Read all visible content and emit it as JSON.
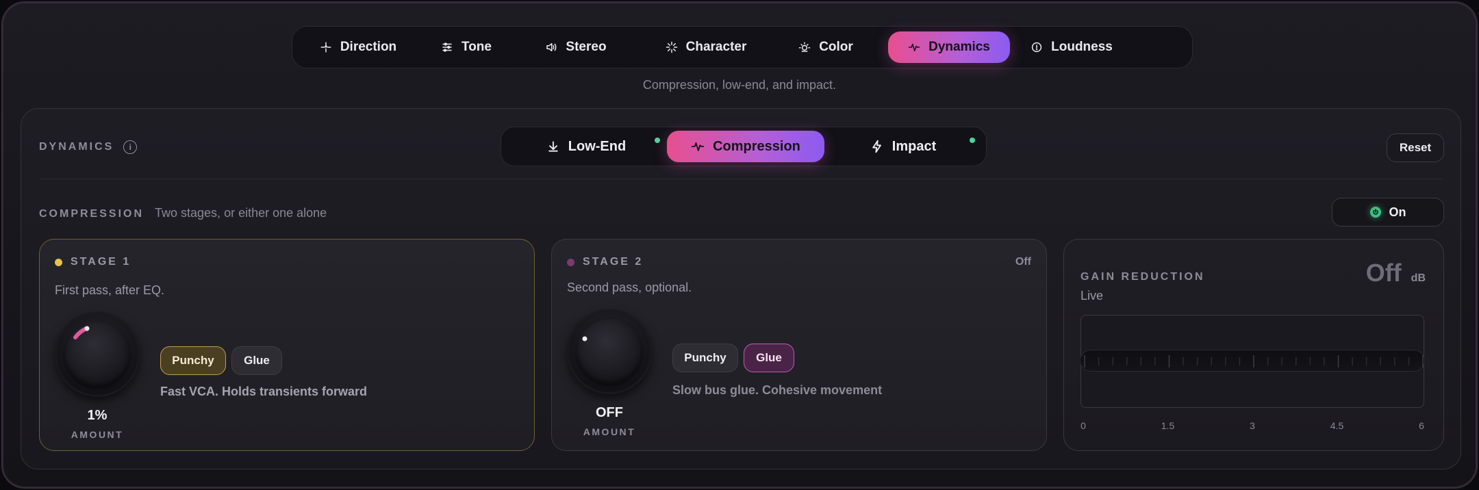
{
  "nav": {
    "items": [
      {
        "label": "Direction",
        "icon": "sparkle-icon"
      },
      {
        "label": "Tone",
        "icon": "sliders-icon"
      },
      {
        "label": "Stereo",
        "icon": "speaker-icon"
      },
      {
        "label": "Character",
        "icon": "burst-icon"
      },
      {
        "label": "Color",
        "icon": "sun-icon"
      },
      {
        "label": "Dynamics",
        "icon": "pulse-icon",
        "active": true
      },
      {
        "label": "Loudness",
        "icon": "gauge-icon"
      }
    ]
  },
  "subtitle": "Compression, low-end, and impact.",
  "panel": {
    "label": "DYNAMICS",
    "info_symbol": "i",
    "reset_label": "Reset",
    "subtabs": [
      {
        "label": "Low-End",
        "icon": "arrow-down-icon",
        "status": true
      },
      {
        "label": "Compression",
        "icon": "pulse-icon",
        "active": true
      },
      {
        "label": "Impact",
        "icon": "bolt-icon",
        "status": true
      }
    ]
  },
  "section": {
    "label": "COMPRESSION",
    "description": "Two stages, or either one alone",
    "toggle_label": "On"
  },
  "stage1": {
    "title": "STAGE 1",
    "description": "First pass, after EQ.",
    "knob_value": "1%",
    "knob_label": "AMOUNT",
    "knob_level": 0.01,
    "modes": [
      "Punchy",
      "Glue"
    ],
    "selected_mode": "Punchy",
    "mode_description": "Fast VCA. Holds transients forward",
    "accent": "#e6c34a"
  },
  "stage2": {
    "title": "STAGE 2",
    "status": "Off",
    "description": "Second pass, optional.",
    "knob_value": "OFF",
    "knob_label": "AMOUNT",
    "knob_level": 0,
    "modes": [
      "Punchy",
      "Glue"
    ],
    "selected_mode": "Glue",
    "mode_description": "Slow bus glue. Cohesive movement",
    "accent": "#c15ab8"
  },
  "gain_reduction": {
    "title": "GAIN REDUCTION",
    "subtitle": "Live",
    "readout": "Off",
    "unit": "dB",
    "scale": [
      "0",
      "1.5",
      "3",
      "4.5",
      "6"
    ]
  },
  "colors": {
    "accent_gradient_start": "#e84f8f",
    "accent_gradient_end": "#8c5bf0",
    "status_green": "#4fd39a"
  }
}
